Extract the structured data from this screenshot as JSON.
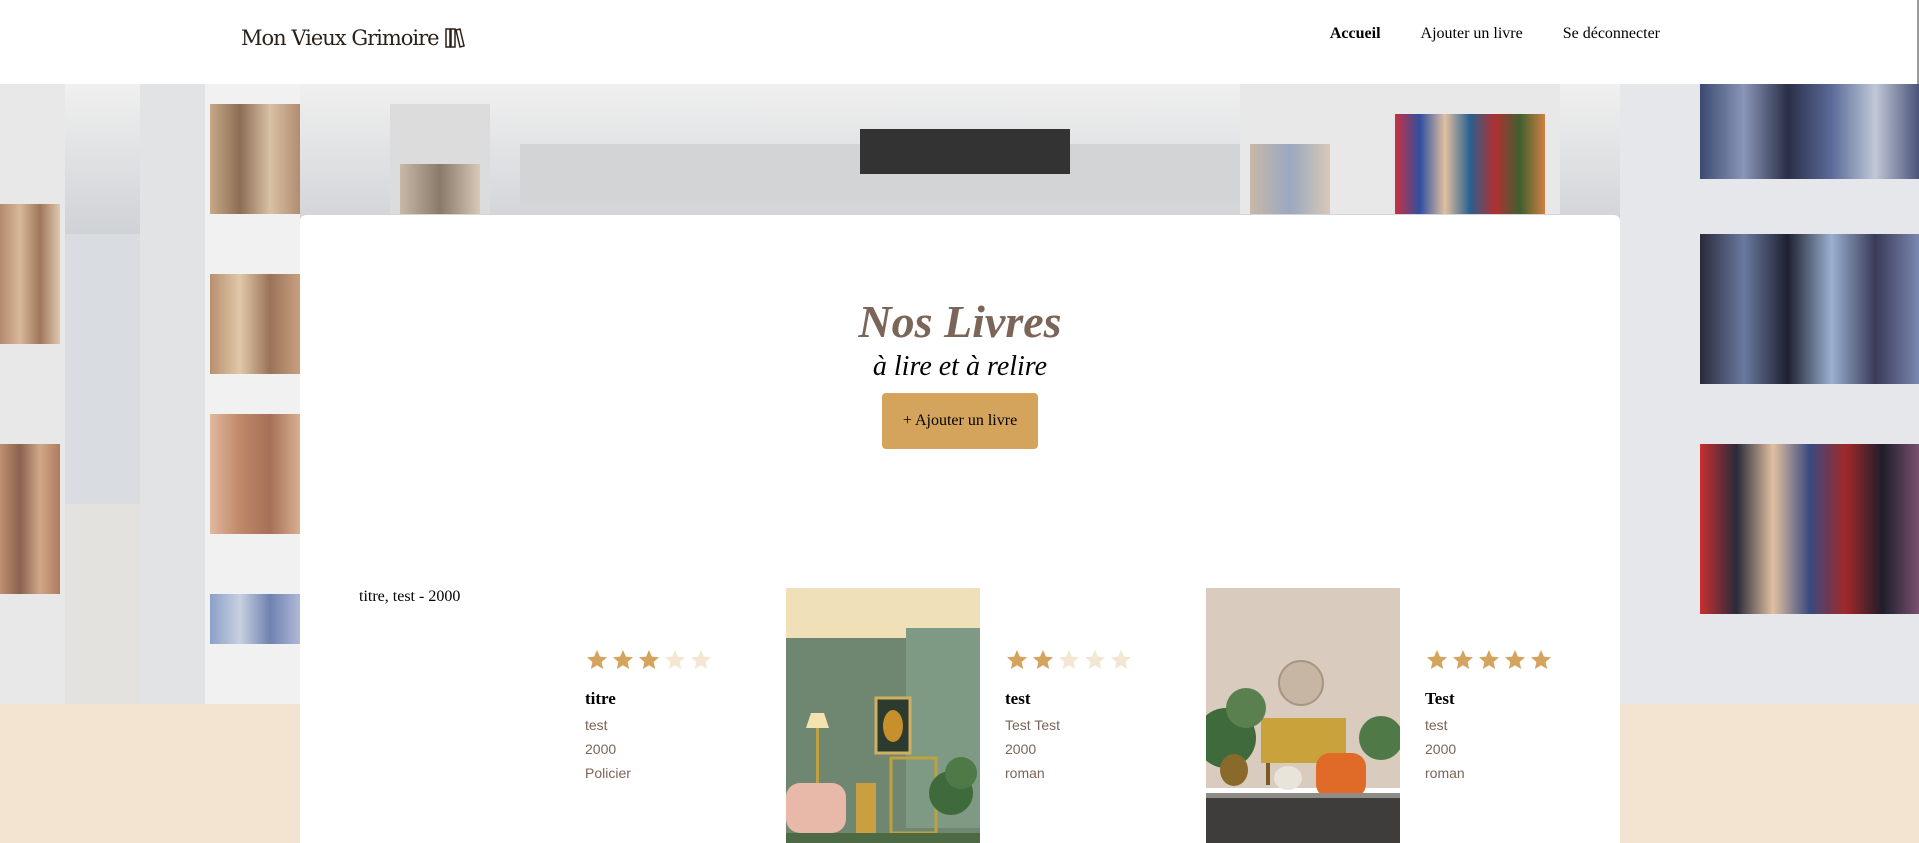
{
  "header": {
    "logo_text": "Mon Vieux Grimoire",
    "logo_icon": "books-icon",
    "nav": [
      {
        "label": "Accueil",
        "active": true
      },
      {
        "label": "Ajouter un livre",
        "active": false
      },
      {
        "label": "Se déconnecter",
        "active": false
      }
    ]
  },
  "main": {
    "title": "Nos Livres",
    "subtitle": "à lire et à relire",
    "add_button_label": "+ Ajouter un livre",
    "books": [
      {
        "image_alt": "titre, test - 2000",
        "rating": 3,
        "title": "titre",
        "author": "test",
        "year": "2000",
        "genre": "Policier"
      },
      {
        "image_alt": "",
        "rating": 2,
        "title": "test",
        "author": "Test Test",
        "year": "2000",
        "genre": "roman"
      },
      {
        "image_alt": "",
        "rating": 5,
        "title": "Test",
        "author": "test",
        "year": "2000",
        "genre": "roman"
      }
    ]
  },
  "colors": {
    "accent": "#d4a35c",
    "star_filled": "#d4a35c",
    "star_empty": "#f3e6d2",
    "muted_text": "#7b6558",
    "footer_beige": "#f2e4d1"
  }
}
